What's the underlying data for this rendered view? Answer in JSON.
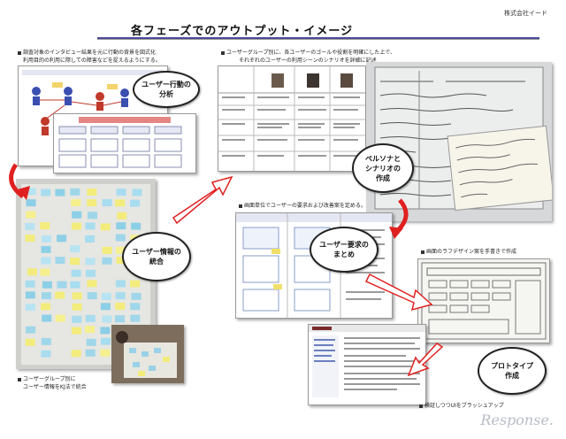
{
  "header": {
    "title": "各フェーズでのアウトプット・イメージ",
    "company": "株式会社イード"
  },
  "captions": {
    "top_left": [
      "調査対象のインタビュー結果を元に行動の背景を図式化",
      "利用目的の利用に際しての障害などを捉えるようにする。"
    ],
    "top_center": [
      "ユーザーグループ別に、各ユーザーのゴールや役割を明確にした上で、",
      "それぞれのユーザーの利用シーンのシナリオを詳細に記述"
    ],
    "bottom_left": [
      "ユーザーグループ別に",
      "ユーザー情報をKJ法で統合"
    ],
    "middle": "画面単位でユーザーの要求および改善案を定める。",
    "right": "画面のラフデザイン案を手書きで作成",
    "bottom_center": "検証しつつUIをブラッシュアップ"
  },
  "phases": {
    "analysis": "ユーザー行動の\n分析",
    "integration": "ユーザー情報の\n統合",
    "persona": "ペルソナと\nシナリオの\n作成",
    "requirements": "ユーザー要求の\nまとめ",
    "prototype": "プロトタイプ\n作成"
  },
  "watermark": "Response."
}
